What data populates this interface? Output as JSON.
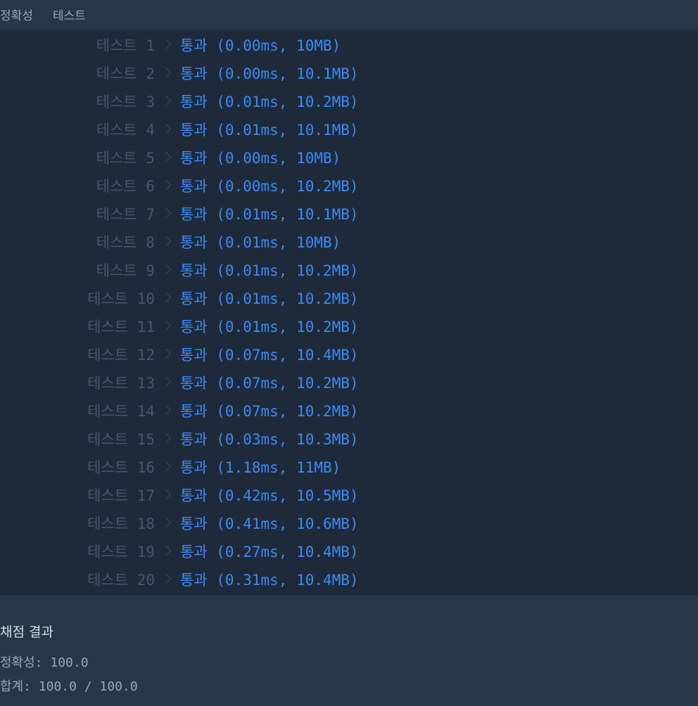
{
  "tabs": [
    {
      "label": "정확성"
    },
    {
      "label": "테스트"
    }
  ],
  "results": [
    {
      "label": "테스트 1",
      "result": "통과 (0.00ms, 10MB)"
    },
    {
      "label": "테스트 2",
      "result": "통과 (0.00ms, 10.1MB)"
    },
    {
      "label": "테스트 3",
      "result": "통과 (0.01ms, 10.2MB)"
    },
    {
      "label": "테스트 4",
      "result": "통과 (0.01ms, 10.1MB)"
    },
    {
      "label": "테스트 5",
      "result": "통과 (0.00ms, 10MB)"
    },
    {
      "label": "테스트 6",
      "result": "통과 (0.00ms, 10.2MB)"
    },
    {
      "label": "테스트 7",
      "result": "통과 (0.01ms, 10.1MB)"
    },
    {
      "label": "테스트 8",
      "result": "통과 (0.01ms, 10MB)"
    },
    {
      "label": "테스트 9",
      "result": "통과 (0.01ms, 10.2MB)"
    },
    {
      "label": "테스트 10",
      "result": "통과 (0.01ms, 10.2MB)"
    },
    {
      "label": "테스트 11",
      "result": "통과 (0.01ms, 10.2MB)"
    },
    {
      "label": "테스트 12",
      "result": "통과 (0.07ms, 10.4MB)"
    },
    {
      "label": "테스트 13",
      "result": "통과 (0.07ms, 10.2MB)"
    },
    {
      "label": "테스트 14",
      "result": "통과 (0.07ms, 10.2MB)"
    },
    {
      "label": "테스트 15",
      "result": "통과 (0.03ms, 10.3MB)"
    },
    {
      "label": "테스트 16",
      "result": "통과 (1.18ms, 11MB)"
    },
    {
      "label": "테스트 17",
      "result": "통과 (0.42ms, 10.5MB)"
    },
    {
      "label": "테스트 18",
      "result": "통과 (0.41ms, 10.6MB)"
    },
    {
      "label": "테스트 19",
      "result": "통과 (0.27ms, 10.4MB)"
    },
    {
      "label": "테스트 20",
      "result": "통과 (0.31ms, 10.4MB)"
    }
  ],
  "summary": {
    "title": "채점 결과",
    "accuracy": "정확성: 100.0",
    "total": "합계: 100.0 / 100.0"
  },
  "colors": {
    "pass": "#3d8af5",
    "label": "#44576c",
    "background": "#1e2a3a",
    "panel": "#263747"
  }
}
